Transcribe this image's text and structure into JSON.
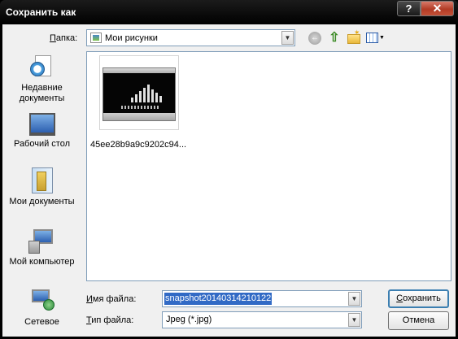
{
  "window": {
    "title": "Сохранить как"
  },
  "titlebar_buttons": {
    "help": "?",
    "close": "✕"
  },
  "folder": {
    "label_prefix": "",
    "label_mnemonic": "П",
    "label_rest": "апка:",
    "current": "Мои рисунки"
  },
  "toolbar": {
    "back_icon": "back-arrow-icon",
    "up_icon": "up-folder-icon",
    "new_folder_icon": "new-folder-icon",
    "views_icon": "views-menu-icon"
  },
  "places": [
    {
      "name": "recent",
      "label_line1": "Недавние",
      "label_line2": "документы"
    },
    {
      "name": "desktop",
      "label_line1": "Рабочий стол",
      "label_line2": ""
    },
    {
      "name": "my-documents",
      "label_line1": "Мои документы",
      "label_line2": ""
    },
    {
      "name": "my-computer",
      "label_line1": "Мой компьютер",
      "label_line2": ""
    },
    {
      "name": "network",
      "label_line1": "Сетевое",
      "label_line2": ""
    }
  ],
  "files": [
    {
      "name": "45ee28b9a9c9202c94..."
    }
  ],
  "filename": {
    "label_mnemonic": "И",
    "label_rest": "мя файла:",
    "value": "snapshot20140314210122"
  },
  "filetype": {
    "label_mnemonic": "Т",
    "label_rest": "ип файла:",
    "value": "Jpeg (*.jpg)"
  },
  "buttons": {
    "save_mnemonic": "С",
    "save_rest": "охранить",
    "cancel": "Отмена"
  },
  "colors": {
    "selection": "#316ac5",
    "dialog_bg": "#f0f0f0",
    "titlebar": "#000000"
  }
}
